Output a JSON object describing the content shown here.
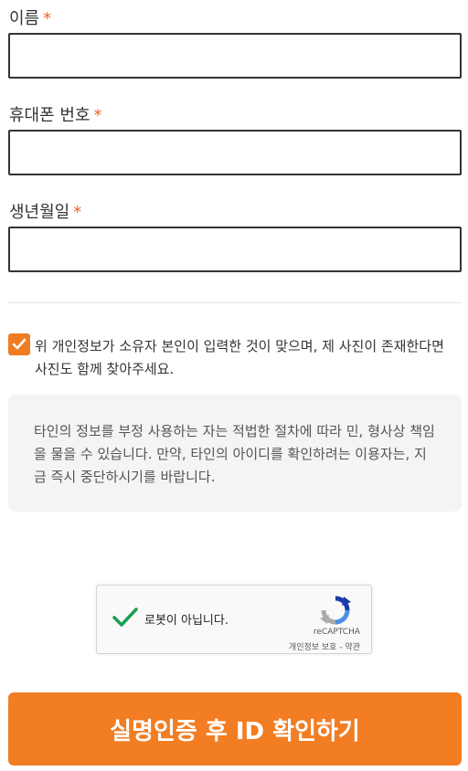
{
  "form": {
    "required_mark": "*",
    "name_label": "이름",
    "name_value": "",
    "phone_label": "휴대폰 번호",
    "phone_value": "",
    "birth_label": "생년월일",
    "birth_value": ""
  },
  "consent": {
    "checked": true,
    "text": "위 개인정보가 소유자 본인이 입력한 것이 맞으며, 제 사진이 존재한다면 사진도 함께 찾아주세요."
  },
  "notice": {
    "text": "타인의 정보를 부정 사용하는 자는 적법한 절차에 따라 민, 형사상 책임을 물을 수 있습니다. 만약, 타인의 아이디를 확인하려는 이용자는, 지금 즉시 중단하시기를 바랍니다."
  },
  "captcha": {
    "checked": true,
    "label": "로봇이 아닙니다.",
    "brand": "reCAPTCHA",
    "links": "개인정보 보호 - 약관"
  },
  "submit": {
    "label": "실명인증 후 ID 확인하기"
  },
  "colors": {
    "accent": "#f27d22",
    "required": "#e8632b",
    "check_green": "#1a9d52"
  }
}
